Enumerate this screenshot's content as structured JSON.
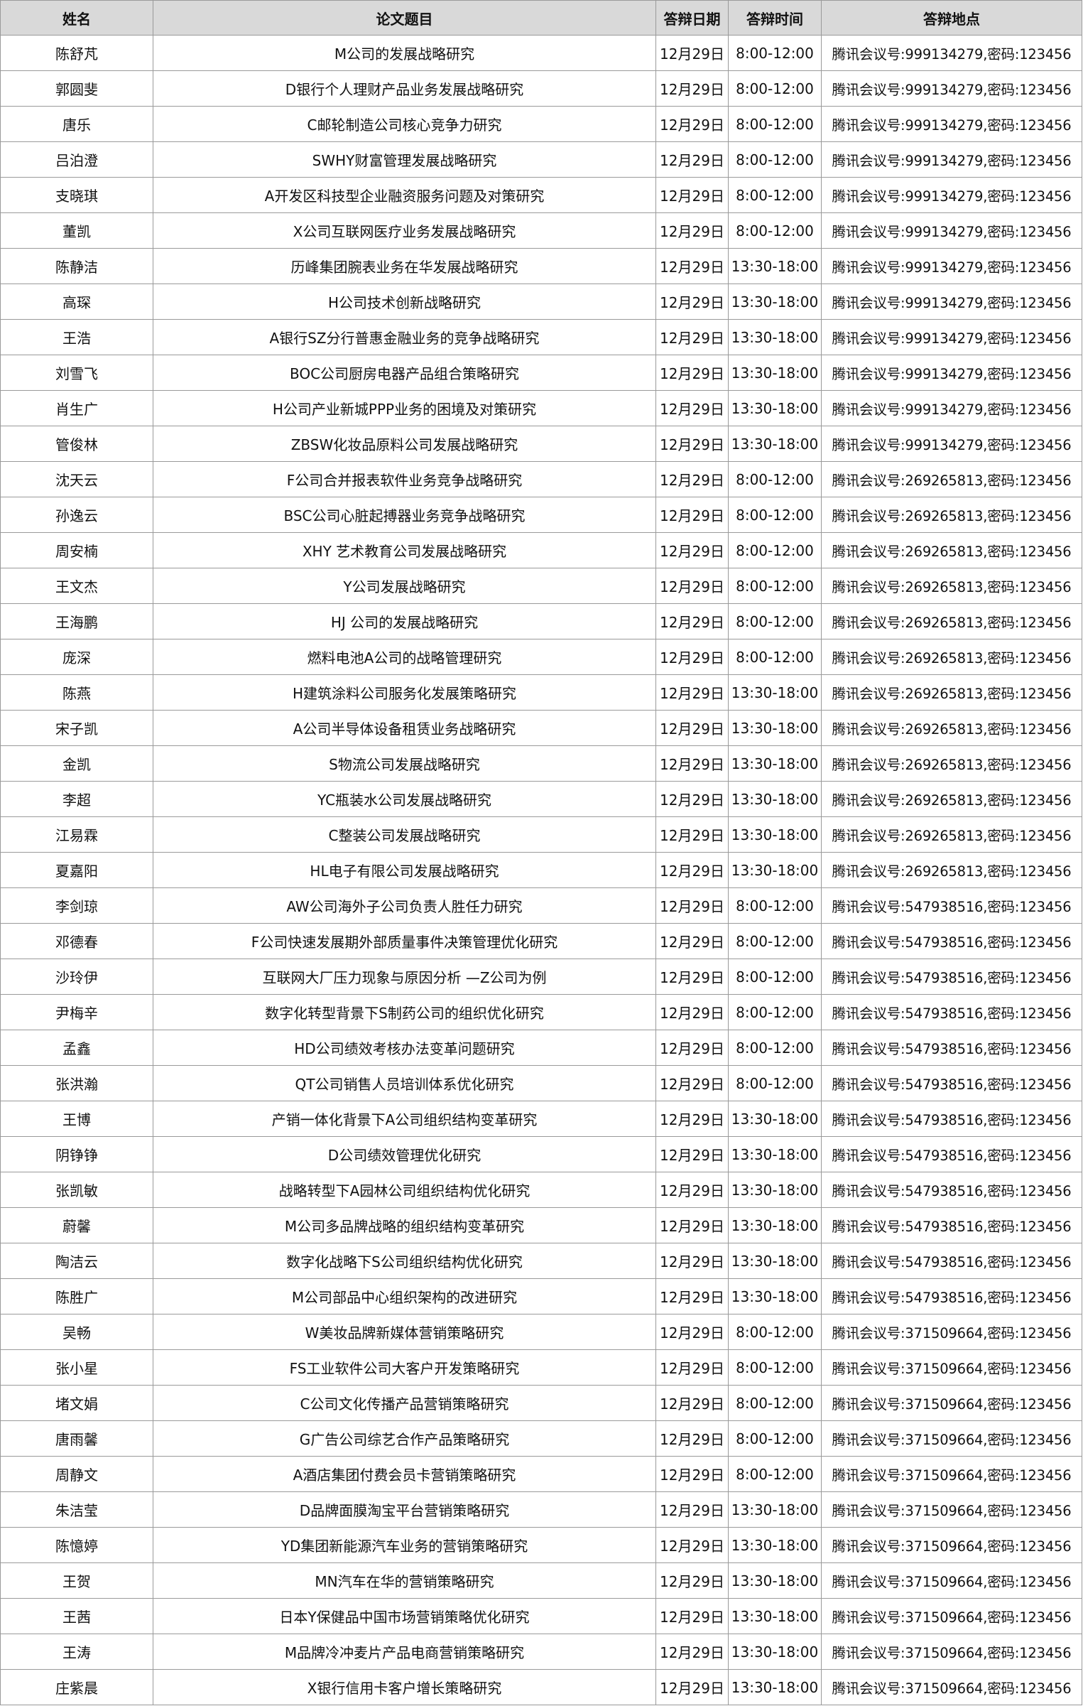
{
  "headers": [
    "姓名",
    "论文题目",
    "答辩日期",
    "答辩时间",
    "答辩地点"
  ],
  "rows": [
    [
      "陈舒芃",
      "M公司的发展战略研究",
      "12月29日",
      "8:00-12:00",
      "腾讯会议号:999134279,密码:123456"
    ],
    [
      "郭圆斐",
      "D银行个人理财产品业务发展战略研究",
      "12月29日",
      "8:00-12:00",
      "腾讯会议号:999134279,密码:123456"
    ],
    [
      "唐乐",
      "C邮轮制造公司核心竞争力研究",
      "12月29日",
      "8:00-12:00",
      "腾讯会议号:999134279,密码:123456"
    ],
    [
      "吕泊澄",
      "SWHY财富管理发展战略研究",
      "12月29日",
      "8:00-12:00",
      "腾讯会议号:999134279,密码:123456"
    ],
    [
      "支晓琪",
      "A开发区科技型企业融资服务问题及对策研究",
      "12月29日",
      "8:00-12:00",
      "腾讯会议号:999134279,密码:123456"
    ],
    [
      "董凯",
      "X公司互联网医疗业务发展战略研究",
      "12月29日",
      "8:00-12:00",
      "腾讯会议号:999134279,密码:123456"
    ],
    [
      "陈静洁",
      "历峰集团腕表业务在华发展战略研究",
      "12月29日",
      "13:30-18:00",
      "腾讯会议号:999134279,密码:123456"
    ],
    [
      "高琛",
      "H公司技术创新战略研究",
      "12月29日",
      "13:30-18:00",
      "腾讯会议号:999134279,密码:123456"
    ],
    [
      "王浩",
      "A银行SZ分行普惠金融业务的竞争战略研究",
      "12月29日",
      "13:30-18:00",
      "腾讯会议号:999134279,密码:123456"
    ],
    [
      "刘雪飞",
      "BOC公司厨房电器产品组合策略研究",
      "12月29日",
      "13:30-18:00",
      "腾讯会议号:999134279,密码:123456"
    ],
    [
      "肖生广",
      "H公司产业新城PPP业务的困境及对策研究",
      "12月29日",
      "13:30-18:00",
      "腾讯会议号:999134279,密码:123456"
    ],
    [
      "管俊林",
      "ZBSW化妆品原料公司发展战略研究",
      "12月29日",
      "13:30-18:00",
      "腾讯会议号:999134279,密码:123456"
    ],
    [
      "沈天云",
      "F公司合并报表软件业务竞争战略研究",
      "12月29日",
      "8:00-12:00",
      "腾讯会议号:269265813,密码:123456"
    ],
    [
      "孙逸云",
      "BSC公司心脏起搏器业务竞争战略研究",
      "12月29日",
      "8:00-12:00",
      "腾讯会议号:269265813,密码:123456"
    ],
    [
      "周安楠",
      "XHY 艺术教育公司发展战略研究",
      "12月29日",
      "8:00-12:00",
      "腾讯会议号:269265813,密码:123456"
    ],
    [
      "王文杰",
      "Y公司发展战略研究",
      "12月29日",
      "8:00-12:00",
      "腾讯会议号:269265813,密码:123456"
    ],
    [
      "王海鹏",
      "HJ 公司的发展战略研究",
      "12月29日",
      "8:00-12:00",
      "腾讯会议号:269265813,密码:123456"
    ],
    [
      "庞深",
      "燃料电池A公司的战略管理研究",
      "12月29日",
      "8:00-12:00",
      "腾讯会议号:269265813,密码:123456"
    ],
    [
      "陈燕",
      "H建筑涂料公司服务化发展策略研究",
      "12月29日",
      "13:30-18:00",
      "腾讯会议号:269265813,密码:123456"
    ],
    [
      "宋子凯",
      "A公司半导体设备租赁业务战略研究",
      "12月29日",
      "13:30-18:00",
      "腾讯会议号:269265813,密码:123456"
    ],
    [
      "金凯",
      "S物流公司发展战略研究",
      "12月29日",
      "13:30-18:00",
      "腾讯会议号:269265813,密码:123456"
    ],
    [
      "李超",
      "YC瓶装水公司发展战略研究",
      "12月29日",
      "13:30-18:00",
      "腾讯会议号:269265813,密码:123456"
    ],
    [
      "江易霖",
      "C整装公司发展战略研究",
      "12月29日",
      "13:30-18:00",
      "腾讯会议号:269265813,密码:123456"
    ],
    [
      "夏嘉阳",
      "HL电子有限公司发展战略研究",
      "12月29日",
      "13:30-18:00",
      "腾讯会议号:269265813,密码:123456"
    ],
    [
      "李剑琼",
      "AW公司海外子公司负责人胜任力研究",
      "12月29日",
      "8:00-12:00",
      "腾讯会议号:547938516,密码:123456"
    ],
    [
      "邓德春",
      "F公司快速发展期外部质量事件决策管理优化研究",
      "12月29日",
      "8:00-12:00",
      "腾讯会议号:547938516,密码:123456"
    ],
    [
      "沙玲伊",
      "互联网大厂压力现象与原因分析 —Z公司为例",
      "12月29日",
      "8:00-12:00",
      "腾讯会议号:547938516,密码:123456"
    ],
    [
      "尹梅辛",
      "数字化转型背景下S制药公司的组织优化研究",
      "12月29日",
      "8:00-12:00",
      "腾讯会议号:547938516,密码:123456"
    ],
    [
      "孟鑫",
      "HD公司绩效考核办法变革问题研究",
      "12月29日",
      "8:00-12:00",
      "腾讯会议号:547938516,密码:123456"
    ],
    [
      "张洪瀚",
      "QT公司销售人员培训体系优化研究",
      "12月29日",
      "8:00-12:00",
      "腾讯会议号:547938516,密码:123456"
    ],
    [
      "王博",
      "产销一体化背景下A公司组织结构变革研究",
      "12月29日",
      "13:30-18:00",
      "腾讯会议号:547938516,密码:123456"
    ],
    [
      "阴铮铮",
      "D公司绩效管理优化研究",
      "12月29日",
      "13:30-18:00",
      "腾讯会议号:547938516,密码:123456"
    ],
    [
      "张凯敏",
      "战略转型下A园林公司组织结构优化研究",
      "12月29日",
      "13:30-18:00",
      "腾讯会议号:547938516,密码:123456"
    ],
    [
      "蔚馨",
      "M公司多品牌战略的组织结构变革研究",
      "12月29日",
      "13:30-18:00",
      "腾讯会议号:547938516,密码:123456"
    ],
    [
      "陶洁云",
      "数字化战略下S公司组织结构优化研究",
      "12月29日",
      "13:30-18:00",
      "腾讯会议号:547938516,密码:123456"
    ],
    [
      "陈胜广",
      "M公司部品中心组织架构的改进研究",
      "12月29日",
      "13:30-18:00",
      "腾讯会议号:547938516,密码:123456"
    ],
    [
      "吴畅",
      "W美妆品牌新媒体营销策略研究",
      "12月29日",
      "8:00-12:00",
      "腾讯会议号:371509664,密码:123456"
    ],
    [
      "张小星",
      "FS工业软件公司大客户开发策略研究",
      "12月29日",
      "8:00-12:00",
      "腾讯会议号:371509664,密码:123456"
    ],
    [
      "堵文娟",
      "C公司文化传播产品营销策略研究",
      "12月29日",
      "8:00-12:00",
      "腾讯会议号:371509664,密码:123456"
    ],
    [
      "唐雨馨",
      "G广告公司综艺合作产品策略研究",
      "12月29日",
      "8:00-12:00",
      "腾讯会议号:371509664,密码:123456"
    ],
    [
      "周静文",
      "A酒店集团付费会员卡营销策略研究",
      "12月29日",
      "8:00-12:00",
      "腾讯会议号:371509664,密码:123456"
    ],
    [
      "朱洁莹",
      "D品牌面膜淘宝平台营销策略研究",
      "12月29日",
      "13:30-18:00",
      "腾讯会议号:371509664,密码:123456"
    ],
    [
      "陈憶婷",
      "YD集团新能源汽车业务的营销策略研究",
      "12月29日",
      "13:30-18:00",
      "腾讯会议号:371509664,密码:123456"
    ],
    [
      "王贺",
      "MN汽车在华的营销策略研究",
      "12月29日",
      "13:30-18:00",
      "腾讯会议号:371509664,密码:123456"
    ],
    [
      "王茜",
      "日本Y保健品中国市场营销策略优化研究",
      "12月29日",
      "13:30-18:00",
      "腾讯会议号:371509664,密码:123456"
    ],
    [
      "王涛",
      "M品牌冷冲麦片产品电商营销策略研究",
      "12月29日",
      "13:30-18:00",
      "腾讯会议号:371509664,密码:123456"
    ],
    [
      "庄紫晨",
      "X银行信用卡客户增长策略研究",
      "12月29日",
      "13:30-18:00",
      "腾讯会议号:371509664,密码:123456"
    ]
  ]
}
